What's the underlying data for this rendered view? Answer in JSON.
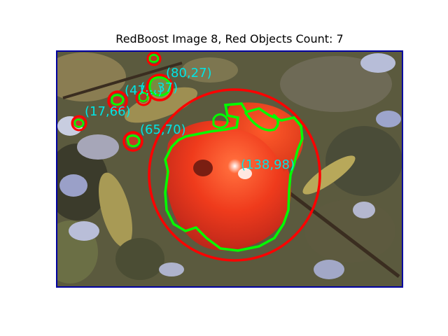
{
  "title": "RedBoost Image 8, Red Objects Count: 7",
  "chart_data": {
    "type": "image",
    "title": "RedBoost Image 8, Red Objects Count: 7",
    "detections": [
      {
        "label": "(80,27)",
        "center": [
          80,
          27
        ]
      },
      {
        "label": "(138,98)",
        "center": [
          138,
          98
        ]
      },
      {
        "label": "(65,70)",
        "center": [
          65,
          70
        ]
      },
      {
        "label": "(17,66)",
        "center": [
          17,
          66
        ]
      },
      {
        "label": "(47,..)",
        "center": [
          47,
          null
        ]
      },
      {
        "label": "(..,37)",
        "center": [
          null,
          37
        ]
      }
    ],
    "colors": {
      "circle": "#ff0000",
      "contour": "#00ff00",
      "label": "#00e5e5",
      "frame": "#0000a0"
    }
  }
}
